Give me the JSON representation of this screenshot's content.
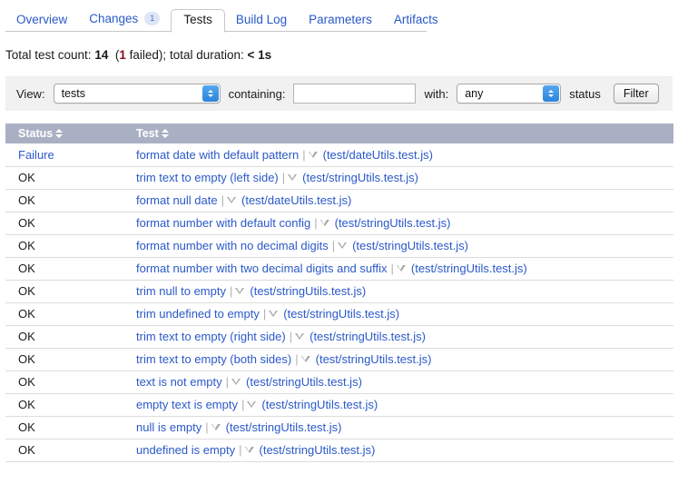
{
  "tabs": [
    {
      "label": "Overview",
      "active": false,
      "badge": null
    },
    {
      "label": "Changes",
      "active": false,
      "badge": "1"
    },
    {
      "label": "Tests",
      "active": true,
      "badge": null
    },
    {
      "label": "Build Log",
      "active": false,
      "badge": null
    },
    {
      "label": "Parameters",
      "active": false,
      "badge": null
    },
    {
      "label": "Artifacts",
      "active": false,
      "badge": null
    }
  ],
  "summary": {
    "prefix": "Total test count:",
    "total": "14",
    "failed_open": "(",
    "failed_count": "1",
    "failed_word": " failed);",
    "duration_label": "total duration:",
    "duration_value": "< 1s"
  },
  "filter": {
    "view_label": "View:",
    "view_value": "tests",
    "containing_label": "containing:",
    "containing_value": "",
    "containing_placeholder": "",
    "with_label": "with:",
    "status_value": "any",
    "status_suffix": "status",
    "filter_button": "Filter"
  },
  "table": {
    "columns": [
      {
        "label": "Status",
        "sortable": true
      },
      {
        "label": "Test",
        "sortable": true
      }
    ],
    "rows": [
      {
        "status": "Failure",
        "failed": true,
        "test": "format date with default pattern",
        "file": "(test/dateUtils.test.js)"
      },
      {
        "status": "OK",
        "failed": false,
        "test": "trim text to empty (left side)",
        "file": "(test/stringUtils.test.js)"
      },
      {
        "status": "OK",
        "failed": false,
        "test": "format null date",
        "file": "(test/dateUtils.test.js)"
      },
      {
        "status": "OK",
        "failed": false,
        "test": "format number with default config",
        "file": "(test/stringUtils.test.js)"
      },
      {
        "status": "OK",
        "failed": false,
        "test": "format number with no decimal digits",
        "file": "(test/stringUtils.test.js)"
      },
      {
        "status": "OK",
        "failed": false,
        "test": "format number with two decimal digits and suffix",
        "file": "(test/stringUtils.test.js)"
      },
      {
        "status": "OK",
        "failed": false,
        "test": "trim null to empty",
        "file": "(test/stringUtils.test.js)"
      },
      {
        "status": "OK",
        "failed": false,
        "test": "trim undefined to empty",
        "file": "(test/stringUtils.test.js)"
      },
      {
        "status": "OK",
        "failed": false,
        "test": "trim text to empty (right side)",
        "file": "(test/stringUtils.test.js)"
      },
      {
        "status": "OK",
        "failed": false,
        "test": "trim text to empty (both sides)",
        "file": "(test/stringUtils.test.js)"
      },
      {
        "status": "OK",
        "failed": false,
        "test": "text is not empty",
        "file": "(test/stringUtils.test.js)"
      },
      {
        "status": "OK",
        "failed": false,
        "test": "empty text is empty",
        "file": "(test/stringUtils.test.js)"
      },
      {
        "status": "OK",
        "failed": false,
        "test": "null is empty",
        "file": "(test/stringUtils.test.js)"
      },
      {
        "status": "OK",
        "failed": false,
        "test": "undefined is empty",
        "file": "(test/stringUtils.test.js)"
      }
    ]
  },
  "colors": {
    "link": "#2a59c8",
    "header_bg": "#aab0c4",
    "fail_text": "#8a1020",
    "filter_bg": "#f1f1f1",
    "badge_bg": "#dde6f7"
  }
}
